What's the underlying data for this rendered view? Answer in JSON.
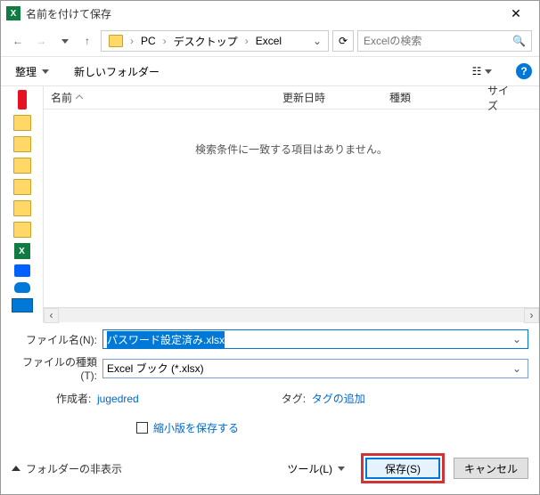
{
  "window": {
    "title": "名前を付けて保存",
    "app_icon_text": "X"
  },
  "nav": {
    "breadcrumb": [
      "PC",
      "デスクトップ",
      "Excel"
    ],
    "search_placeholder": "Excelの検索"
  },
  "toolbar": {
    "organize": "整理",
    "new_folder": "新しいフォルダー"
  },
  "columns": {
    "name": "名前",
    "date": "更新日時",
    "type": "種類",
    "size": "サイズ"
  },
  "list": {
    "empty_message": "検索条件に一致する項目はありません。"
  },
  "form": {
    "filename_label": "ファイル名(N):",
    "filename_value": "パスワード設定済み.xlsx",
    "filetype_label": "ファイルの種類(T):",
    "filetype_value": "Excel ブック (*.xlsx)",
    "author_label": "作成者:",
    "author_value": "jugedred",
    "tag_label": "タグ:",
    "tag_value": "タグの追加",
    "thumbnail_checkbox": "縮小版を保存する"
  },
  "footer": {
    "hide_folders": "フォルダーの非表示",
    "tools": "ツール(L)",
    "save": "保存(S)",
    "cancel": "キャンセル"
  }
}
